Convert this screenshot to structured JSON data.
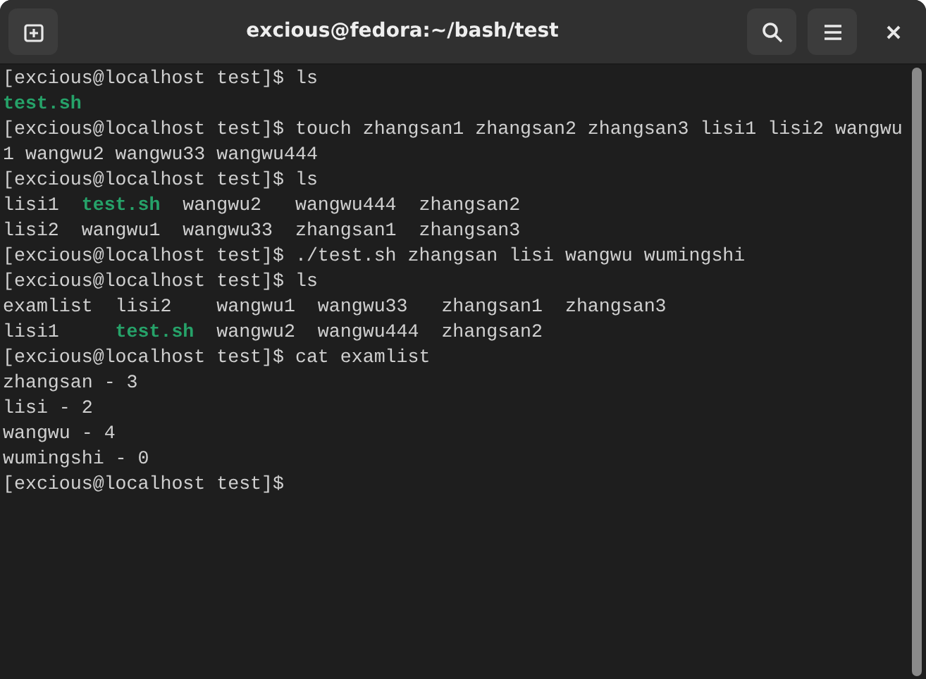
{
  "window": {
    "title": "excious@fedora:~/bash/test"
  },
  "terminal": {
    "lines": [
      [
        {
          "kind": "plain",
          "text": "[excious@localhost test]$ ls"
        }
      ],
      [
        {
          "kind": "exec",
          "text": "test.sh"
        }
      ],
      [
        {
          "kind": "plain",
          "text": "[excious@localhost test]$ touch zhangsan1 zhangsan2 zhangsan3 lisi1 lisi2 wangwu"
        }
      ],
      [
        {
          "kind": "plain",
          "text": "1 wangwu2 wangwu33 wangwu444"
        }
      ],
      [
        {
          "kind": "plain",
          "text": "[excious@localhost test]$ ls"
        }
      ],
      [
        {
          "kind": "plain",
          "text": "lisi1  "
        },
        {
          "kind": "exec",
          "text": "test.sh"
        },
        {
          "kind": "plain",
          "text": "  wangwu2   wangwu444  zhangsan2"
        }
      ],
      [
        {
          "kind": "plain",
          "text": "lisi2  wangwu1  wangwu33  zhangsan1  zhangsan3"
        }
      ],
      [
        {
          "kind": "plain",
          "text": "[excious@localhost test]$ ./test.sh zhangsan lisi wangwu wumingshi"
        }
      ],
      [
        {
          "kind": "plain",
          "text": "[excious@localhost test]$ ls"
        }
      ],
      [
        {
          "kind": "plain",
          "text": "examlist  lisi2    wangwu1  wangwu33   zhangsan1  zhangsan3"
        }
      ],
      [
        {
          "kind": "plain",
          "text": "lisi1     "
        },
        {
          "kind": "exec",
          "text": "test.sh"
        },
        {
          "kind": "plain",
          "text": "  wangwu2  wangwu444  zhangsan2"
        }
      ],
      [
        {
          "kind": "plain",
          "text": "[excious@localhost test]$ cat examlist"
        }
      ],
      [
        {
          "kind": "plain",
          "text": "zhangsan - 3"
        }
      ],
      [
        {
          "kind": "plain",
          "text": "lisi - 2"
        }
      ],
      [
        {
          "kind": "plain",
          "text": "wangwu - 4"
        }
      ],
      [
        {
          "kind": "plain",
          "text": "wumingshi - 0"
        }
      ],
      [
        {
          "kind": "plain",
          "text": "[excious@localhost test]$"
        }
      ]
    ]
  }
}
